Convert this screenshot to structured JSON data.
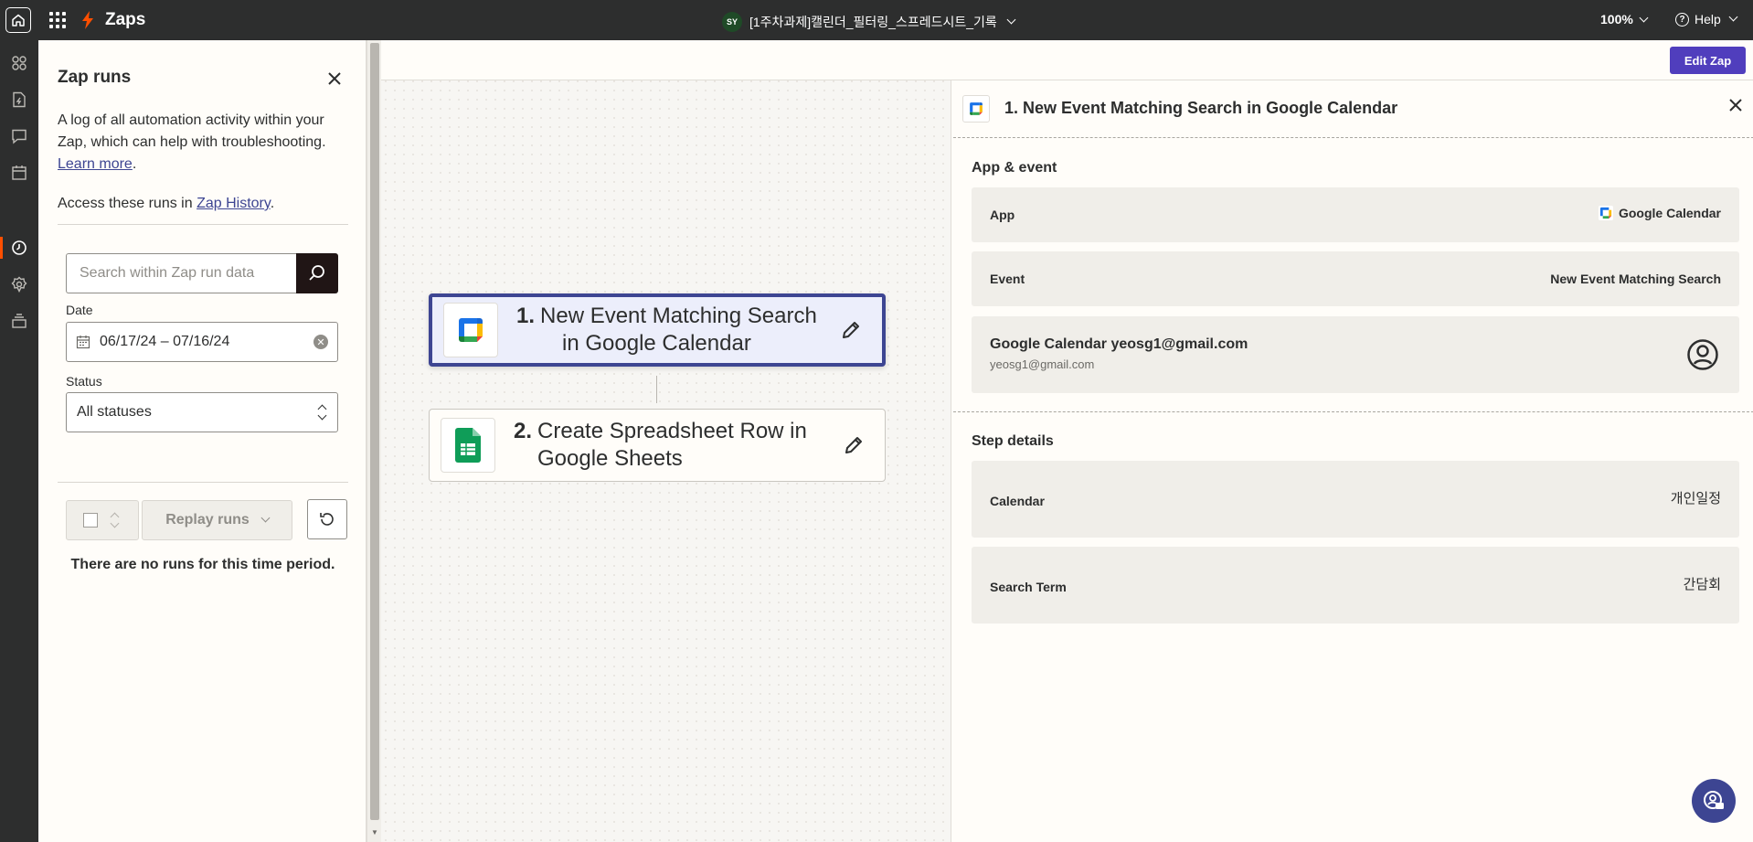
{
  "topbar": {
    "app_name": "Zaps",
    "owner_initials": "SY",
    "zap_title": "[1주차과제]캘린더_필터링_스프레드시트_기록",
    "zoom": "100%",
    "help": "Help"
  },
  "sidebar_icons": [
    "apps-icon",
    "zap-file-icon",
    "comment-icon",
    "calendar-icon",
    "history-icon",
    "settings-icon",
    "versions-icon"
  ],
  "runs_panel": {
    "title": "Zap runs",
    "description": "A log of all automation activity within your Zap, which can help with troubleshooting.",
    "learn_more": "Learn more",
    "access_prefix": "Access these runs in",
    "zap_history_link": "Zap History",
    "search_placeholder": "Search within Zap run data",
    "date_label": "Date",
    "date_value": "06/17/24 – 07/16/24",
    "status_label": "Status",
    "status_value": "All statuses",
    "replay_label": "Replay runs",
    "empty_message": "There are no runs for this time period."
  },
  "toolbar": {
    "edit_zap": "Edit Zap"
  },
  "steps": [
    {
      "number": "1.",
      "line1": "New Event Matching Search",
      "line2": "in Google Calendar",
      "app": "google-calendar"
    },
    {
      "number": "2.",
      "line1": "Create Spreadsheet Row in",
      "line2": "Google Sheets",
      "app": "google-sheets"
    }
  ],
  "detail": {
    "title": "1. New Event Matching Search in Google Calendar",
    "app_event_title": "App & event",
    "app_label": "App",
    "app_value": "Google Calendar",
    "event_label": "Event",
    "event_value": "New Event Matching Search",
    "account_main": "Google Calendar yeosg1@gmail.com",
    "account_sub": "yeosg1@gmail.com",
    "step_details_title": "Step details",
    "calendar_label": "Calendar",
    "calendar_value": "개인일정",
    "search_term_label": "Search Term",
    "search_term_value": "간담회"
  },
  "colors": {
    "topbar": "#2d2e2e",
    "accent": "#503ebd",
    "zapier_orange": "#ff4f00",
    "active_step_border": "#3d4592",
    "link": "#3d4592"
  }
}
